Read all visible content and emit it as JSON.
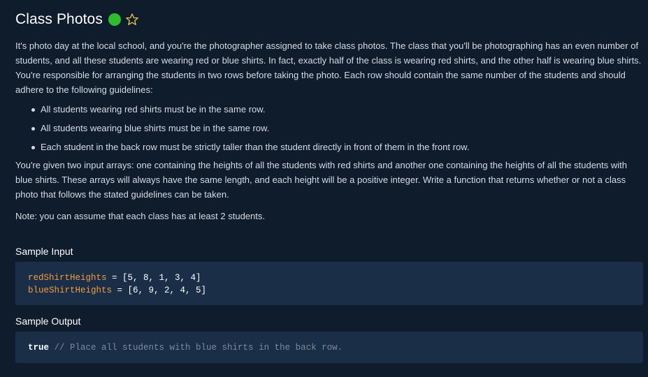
{
  "title": "Class Photos",
  "status_color": "#2ebd2e",
  "icons": {
    "status": "status-dot-icon",
    "favorite": "star-outline-icon"
  },
  "description": {
    "paragraph1": "It's photo day at the local school, and you're the photographer assigned to take class photos. The class that you'll be photographing has an even number of students, and all these students are wearing red or blue shirts. In fact, exactly half of the class is wearing red shirts, and the other half is wearing blue shirts. You're responsible for arranging the students in two rows before taking the photo. Each row should contain the same number of the students and should adhere to the following guidelines:",
    "bullets": [
      "All students wearing red shirts must be in the same row.",
      "All students wearing blue shirts must be in the same row.",
      "Each student in the back row must be strictly taller than the student directly in front of them in the front row."
    ],
    "paragraph2": "You're given two input arrays: one containing the heights of all the students with red shirts and another one containing the heights of all the students with blue shirts. These arrays will always have the same length, and each height will be a positive integer. Write a function that returns whether or not a class photo that follows the stated guidelines can be taken.",
    "note": "Note: you can assume that each class has at least 2 students."
  },
  "sample_input": {
    "heading": "Sample Input",
    "lines": [
      {
        "name": "redShirtHeights",
        "value": " = [5, 8, 1, 3, 4]"
      },
      {
        "name": "blueShirtHeights",
        "value": " = [6, 9, 2, 4, 5]"
      }
    ]
  },
  "sample_output": {
    "heading": "Sample Output",
    "value": "true",
    "comment": " // Place all students with blue shirts in the back row."
  }
}
